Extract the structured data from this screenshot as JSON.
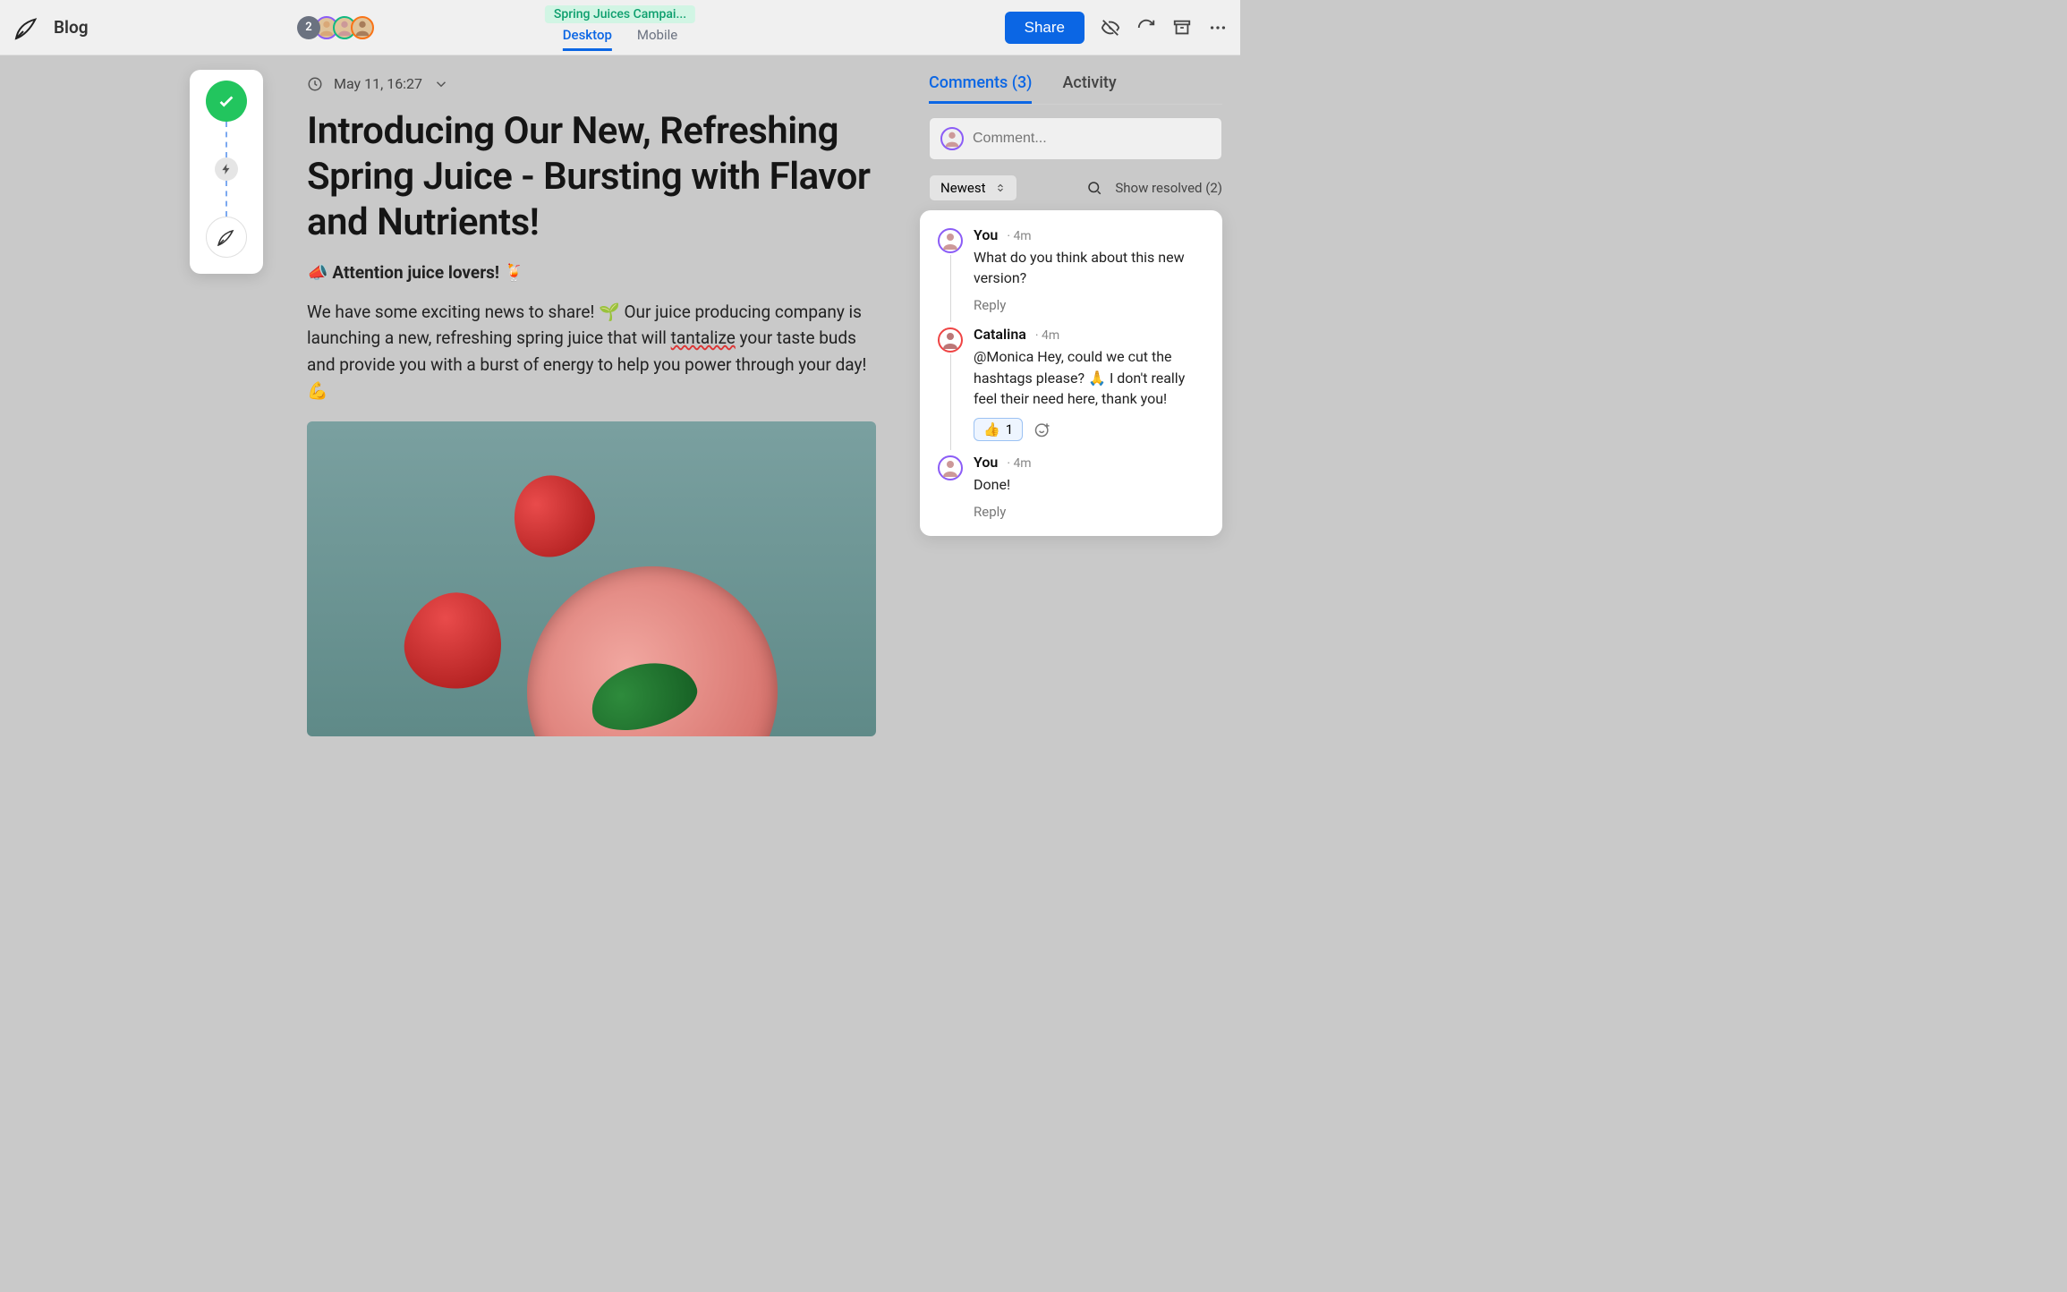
{
  "header": {
    "title": "Blog",
    "avatar_overflow": "2",
    "campaign": "Spring Juices Campai...",
    "device_tabs": {
      "desktop": "Desktop",
      "mobile": "Mobile"
    },
    "share_label": "Share"
  },
  "content": {
    "date": "May 11, 16:27",
    "title": "Introducing Our New, Refreshing Spring Juice - Bursting with Flavor and Nutrients!",
    "lead_prefix": "📣 ",
    "lead_text": "Attention juice lovers!",
    "lead_suffix": " 🍹",
    "body_pre": "We have some exciting news to share! 🌱 Our juice producing company is launching a new, refreshing spring juice that will ",
    "body_spell": "tantalize",
    "body_post": " your taste buds and provide you with a burst of energy to help you power through your day! 💪"
  },
  "sidebar": {
    "tabs": {
      "comments": "Comments (3)",
      "activity": "Activity"
    },
    "compose_placeholder": "Comment...",
    "sort_label": "Newest",
    "show_resolved": "Show resolved (2)",
    "thread": [
      {
        "author": "You",
        "time": "· 4m",
        "body": "What do you think about this new version?",
        "reply_label": "Reply"
      },
      {
        "author": "Catalina",
        "time": "· 4m",
        "body": "@Monica Hey, could we cut the hashtags please? 🙏 I don't really feel their need here, thank you!",
        "reaction_emoji": "👍",
        "reaction_count": "1"
      },
      {
        "author": "You",
        "time": "· 4m",
        "body": "Done!",
        "reply_label": "Reply"
      }
    ]
  }
}
